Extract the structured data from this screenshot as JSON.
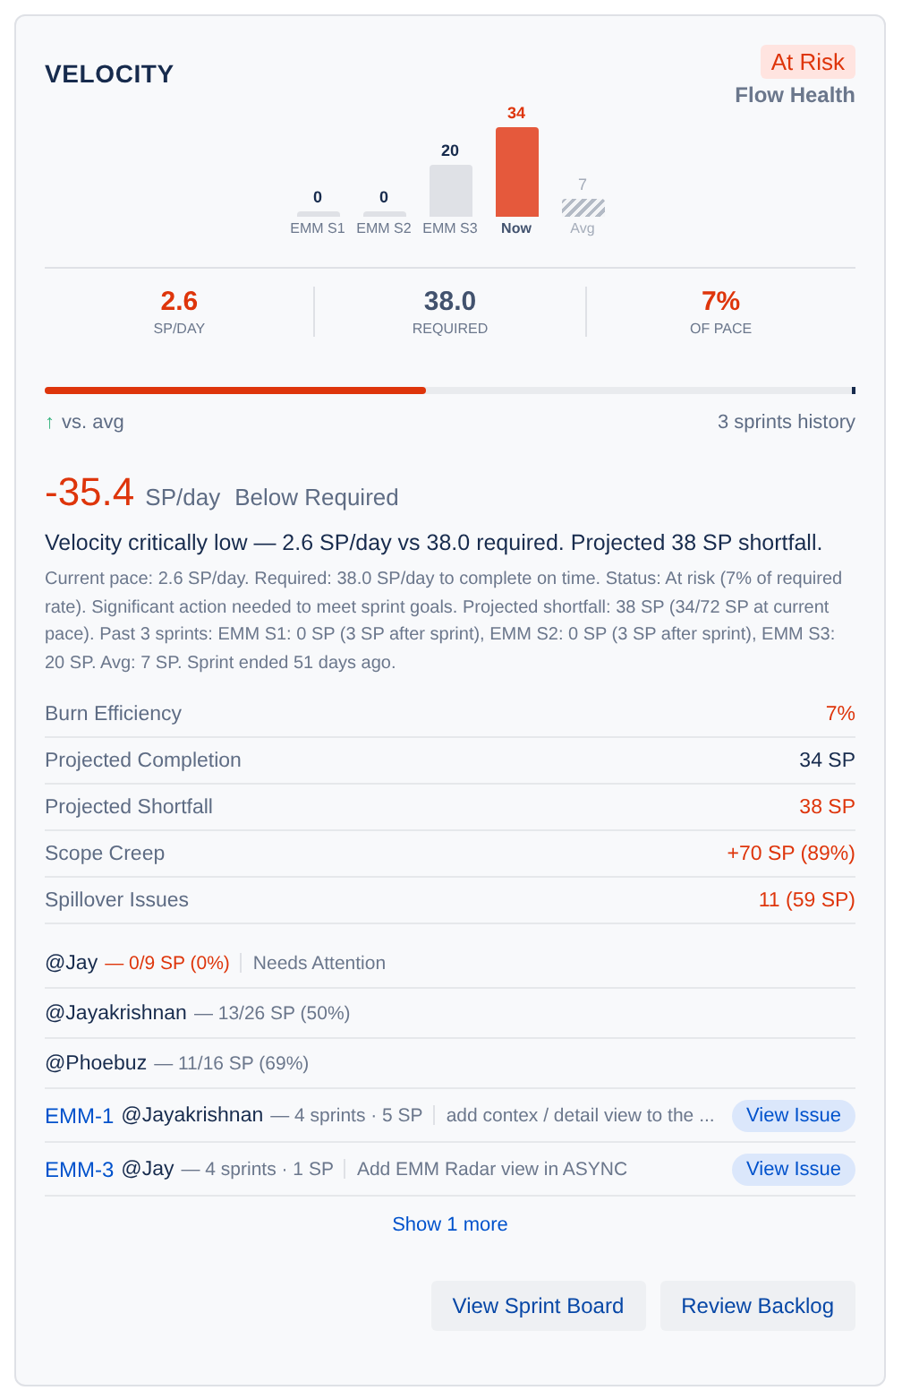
{
  "card": {
    "title": "VELOCITY",
    "status_badge": "At Risk",
    "subtitle": "Flow Health"
  },
  "velocity_chart": {
    "chart_data": {
      "type": "bar",
      "categories": [
        "EMM S1",
        "EMM S2",
        "EMM S3",
        "Now",
        "Avg"
      ],
      "data_labels": true,
      "series": [
        {
          "color": "#dfe1e6",
          "values": [
            0,
            0,
            20,
            null,
            null
          ]
        },
        {
          "color": "#e5593c",
          "values": [
            null,
            null,
            null,
            34,
            null
          ]
        },
        {
          "color": "#b3bac5",
          "values": [
            null,
            null,
            null,
            null,
            7
          ]
        }
      ]
    }
  },
  "stats": [
    {
      "value": "2.6",
      "label": "SP/DAY",
      "alert": true
    },
    {
      "value": "38.0",
      "label": "REQUIRED",
      "alert": false
    },
    {
      "value": "7%",
      "label": "OF PACE",
      "alert": true
    }
  ],
  "progress": {
    "level": 0.47,
    "trend_icon": "↑",
    "trend_label": "vs. avg",
    "history": "3 sprints history"
  },
  "delta": {
    "value": "-35.4",
    "unit": "SP/day",
    "label": "Below Required"
  },
  "headline": "Velocity critically low — 2.6 SP/day vs 38.0 required. Projected 38 SP shortfall.",
  "description": "Current pace: 2.6 SP/day. Required: 38.0 SP/day to complete on time. Status: At risk (7% of required rate). Significant action needed to meet sprint goals. Projected shortfall: 38 SP (34/72 SP at current pace). Past 3 sprints: EMM S1: 0 SP (3 SP after sprint), EMM S2: 0 SP (3 SP after sprint), EMM S3: 20 SP. Avg: 7 SP. Sprint ended 51 days ago.",
  "metrics": [
    {
      "label": "Burn Efficiency",
      "value": "7%",
      "alert": true
    },
    {
      "label": "Projected Completion",
      "value": "34 SP",
      "alert": false
    },
    {
      "label": "Projected Shortfall",
      "value": "38 SP",
      "alert": true
    },
    {
      "label": "Scope Creep",
      "value": "+70 SP (89%)",
      "alert": true
    },
    {
      "label": "Spillover Issues",
      "value": "11 (59 SP)",
      "alert": true
    }
  ],
  "members": [
    {
      "name": "@Jay",
      "stats": "— 0/9 SP (0%)",
      "alert": true,
      "note": "Needs Attention"
    },
    {
      "name": "@Jayakrishnan",
      "stats": "— 13/26 SP (50%)",
      "alert": false
    },
    {
      "name": "@Phoebuz",
      "stats": "— 11/16 SP (69%)",
      "alert": false
    }
  ],
  "issues": [
    {
      "key": "EMM-1",
      "assignee": "@Jayakrishnan",
      "meta": "— 4 sprints · 5 SP",
      "title": "add contex / detail view to the ...",
      "action": "View Issue"
    },
    {
      "key": "EMM-3",
      "assignee": "@Jay",
      "meta": "— 4 sprints · 1 SP",
      "title": "Add EMM Radar view in ASYNC",
      "action": "View Issue"
    }
  ],
  "show_more": "Show 1 more",
  "buttons": [
    "View Sprint Board",
    "Review Backlog"
  ]
}
